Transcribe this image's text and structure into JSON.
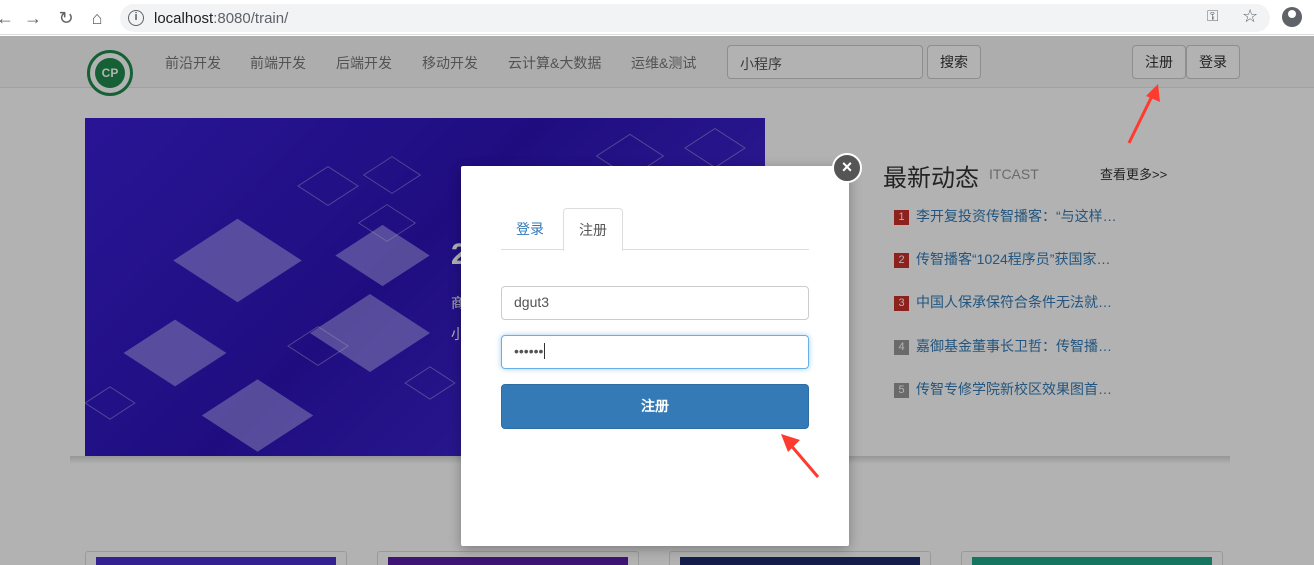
{
  "browser": {
    "url_host": "localhost",
    "url_rest": ":8080/train/"
  },
  "site": {
    "logo_text": "CP",
    "menu": [
      "前沿开发",
      "前端开发",
      "后端开发",
      "移动开发",
      "云计算&大数据",
      "运维&测试"
    ],
    "search_value": "小程序",
    "search_button": "搜索",
    "register_button": "注册",
    "login_button": "登录"
  },
  "banner": {
    "fragments": [
      "2",
      "商",
      "小"
    ]
  },
  "news": {
    "title": "最新动态",
    "subtitle": "ITCAST",
    "more": "查看更多>>",
    "items": [
      {
        "num": "1",
        "text": "李开复投资传智播客：“与这样…",
        "hot": true
      },
      {
        "num": "2",
        "text": "传智播客“1024程序员”获国家…",
        "hot": true
      },
      {
        "num": "3",
        "text": "中国人保承保符合条件无法就…",
        "hot": true
      },
      {
        "num": "4",
        "text": "嘉御基金董事长卫哲：传智播…",
        "hot": false
      },
      {
        "num": "5",
        "text": "传智专修学院新校区效果图首…",
        "hot": false
      }
    ]
  },
  "modal": {
    "close_symbol": "×",
    "tab_login": "登录",
    "tab_register": "注册",
    "username_value": "dgut3",
    "password_value": "••••••",
    "submit_label": "注册"
  },
  "colors": {
    "primary": "#337ab7",
    "hot_badge": "#c9302c",
    "normal_badge": "#999999",
    "annotation_arrow": "#ff3b30"
  }
}
